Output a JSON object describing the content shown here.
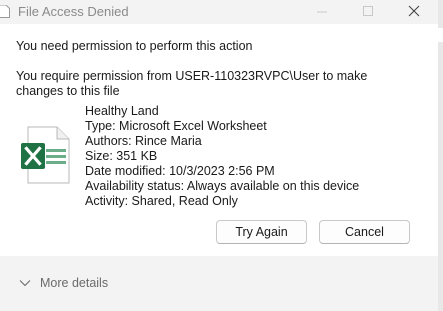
{
  "window": {
    "title": "File Access Denied"
  },
  "message": {
    "heading": "You need permission to perform this action",
    "detail": "You require permission from USER-110323RVPC\\User to make changes to this file"
  },
  "file": {
    "icon": "excel-file-icon",
    "name": "Healthy Land",
    "type": "Type: Microsoft Excel Worksheet",
    "authors": "Authors: Rince Maria",
    "size": "Size: 351 KB",
    "date_modified": "Date modified: 10/3/2023 2:56 PM",
    "availability": "Availability status: Always available on this device",
    "activity": "Activity: Shared, Read Only"
  },
  "buttons": {
    "retry_label": "Try Again",
    "cancel_label": "Cancel"
  },
  "footer": {
    "more_details_label": "More details"
  },
  "colors": {
    "excel_green": "#1f7244",
    "title_text": "#8a8a8a",
    "chrome_background": "#f3f3f3"
  }
}
